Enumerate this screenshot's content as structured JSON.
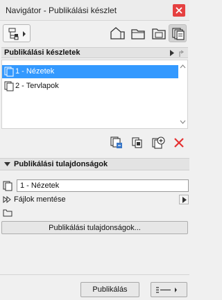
{
  "window": {
    "title": "Navigátor - Publikálási készlet"
  },
  "toolbar": {
    "icons": [
      "navigator-menu-icon",
      "project-map-icon",
      "view-map-icon",
      "layout-book-icon",
      "publisher-sets-icon"
    ]
  },
  "set_list": {
    "header": "Publikálási készletek",
    "items": [
      {
        "label": "1 - Nézetek",
        "selected": true
      },
      {
        "label": "2 - Tervlapok",
        "selected": false
      }
    ]
  },
  "actions": {
    "icons": [
      "new-publisher-set-icon",
      "duplicate-set-icon",
      "add-set-icon",
      "delete-icon"
    ]
  },
  "properties": {
    "header": "Publikálási tulajdonságok",
    "name_value": "1 - Nézetek",
    "save_label": "Fájlok mentése",
    "properties_button": "Publikálási tulajdonságok..."
  },
  "footer": {
    "publish_button": "Publikálás"
  },
  "colors": {
    "selection": "#3399ff",
    "close": "#e54040",
    "delete": "#e53030"
  }
}
